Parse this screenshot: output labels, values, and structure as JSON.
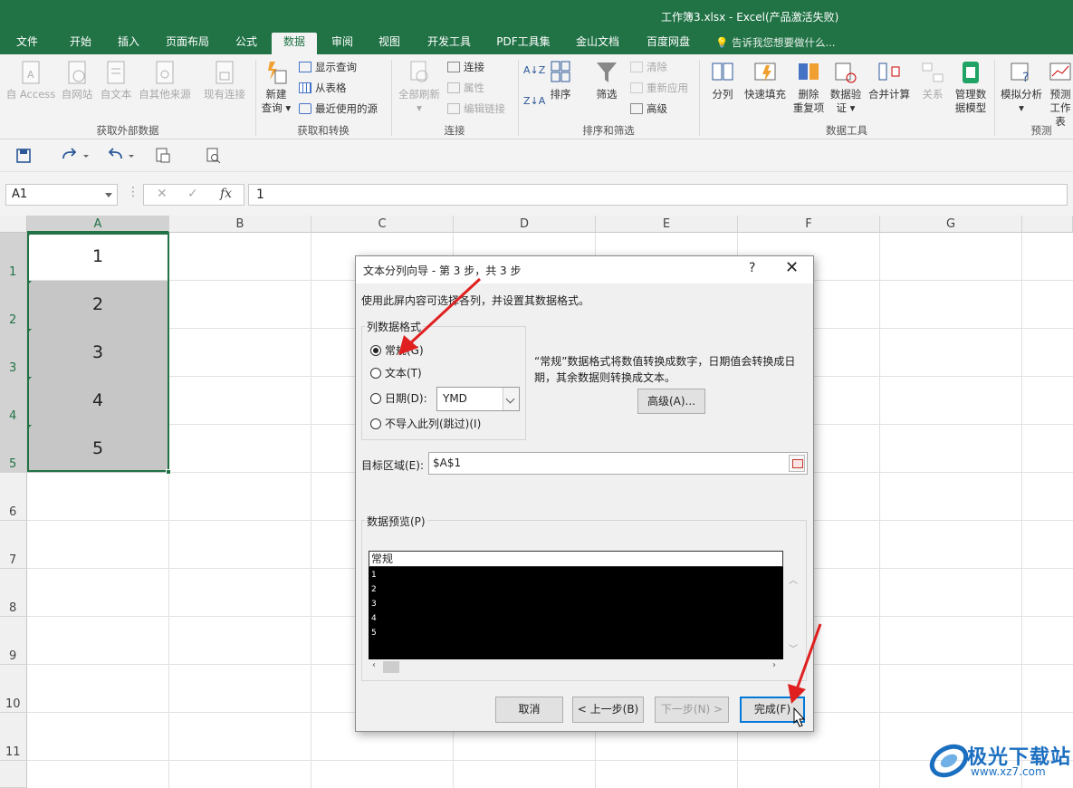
{
  "app": {
    "window_title": "工作簿3.xlsx - Excel(产品激活失败)",
    "tabs": [
      "文件",
      "开始",
      "插入",
      "页面布局",
      "公式",
      "数据",
      "审阅",
      "视图",
      "开发工具",
      "PDF工具集",
      "金山文档",
      "百度网盘"
    ],
    "active_tab": "数据",
    "tell_me": "告诉我您想要做什么..."
  },
  "ribbon": {
    "get_external": {
      "label": "获取外部数据",
      "buttons": [
        "自 Access",
        "自网站",
        "自文本",
        "自其他来源",
        "现有连接"
      ]
    },
    "get_transform": {
      "label": "获取和转换",
      "new_query_line1": "新建",
      "new_query_line2": "查询",
      "items": [
        "显示查询",
        "从表格",
        "最近使用的源"
      ]
    },
    "connections": {
      "label": "连接",
      "refresh_all": "全部刷新",
      "items": [
        "连接",
        "属性",
        "编辑链接"
      ]
    },
    "sort_filter": {
      "label": "排序和筛选",
      "sort": "排序",
      "filter": "筛选",
      "items": [
        "清除",
        "重新应用",
        "高级"
      ]
    },
    "data_tools": {
      "label": "数据工具",
      "buttons": [
        "分列",
        "快速填充",
        "删除",
        "重复项",
        "数据验",
        "证",
        "合并计算",
        "关系",
        "管理数",
        "据模型"
      ]
    },
    "forecast": {
      "label": "预测",
      "buttons": [
        "模拟分析",
        "预测",
        "工作表"
      ]
    }
  },
  "formula_bar": {
    "name_box": "A1",
    "fx": "fx",
    "value": "1"
  },
  "sheet": {
    "columns": [
      "A",
      "B",
      "C",
      "D",
      "E",
      "F",
      "G"
    ],
    "rows": [
      "1",
      "2",
      "3",
      "4",
      "5",
      "6",
      "7",
      "8",
      "9",
      "10",
      "11"
    ],
    "cells": [
      "1",
      "2",
      "3",
      "4",
      "5"
    ]
  },
  "dialog": {
    "title": "文本分列向导 - 第 3 步，共 3 步",
    "help": "?",
    "close": "✕",
    "description": "使用此屏内容可选择各列，并设置其数据格式。",
    "format_group": "列数据格式",
    "options": [
      "常规(G)",
      "文本(T)",
      "日期(D):",
      "不导入此列(跳过)(I)"
    ],
    "selected_option": "常规(G)",
    "date_format": "YMD",
    "explanation": "“常规”数据格式将数值转换成数字，日期值会转换成日期，其余数据则转换成文本。",
    "advanced_button": "高级(A)...",
    "destination_label": "目标区域(E):",
    "destination_value": "$A$1",
    "preview_label": "数据预览(P)",
    "preview_header": "常规",
    "preview_rows": [
      "1",
      "2",
      "3",
      "4",
      "5"
    ],
    "buttons": {
      "cancel": "取消",
      "back": "< 上一步(B)",
      "next": "下一步(N) >",
      "finish": "完成(F)"
    }
  },
  "watermark": {
    "name": "极光下载站",
    "url": "www.xz7.com"
  },
  "colors": {
    "excel_green": "#217346",
    "selection_fill": "#c6c6c6",
    "preview_bg": "#000000",
    "arrow_red": "#e02020"
  }
}
